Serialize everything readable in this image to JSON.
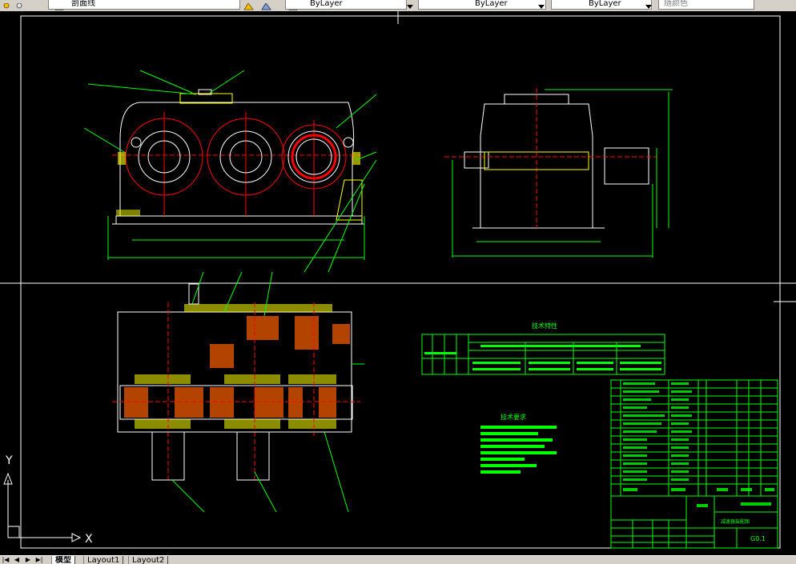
{
  "toolbar": {
    "layer_name": "剖面线",
    "color_control": "ByLayer",
    "linetype_control": "ByLayer",
    "lineweight_control": "ByLayer",
    "plotstyle_control": "随颜色"
  },
  "drawing": {
    "tech_params_title": "技术特性",
    "tech_requirements_title": "技术要求",
    "drawing_no": "G0.1",
    "assembly_title": "减速器装配图",
    "axis_x": "X",
    "axis_y": "Y"
  },
  "tabs": {
    "model": "模型",
    "layout1": "Layout1",
    "layout2": "Layout2"
  },
  "colors": {
    "background": "#000000",
    "geometry": "#ffffff",
    "centerline": "#ff0000",
    "dimension": "#00ff00",
    "hatch": "#ffff00",
    "title_block": "#00ff00"
  }
}
